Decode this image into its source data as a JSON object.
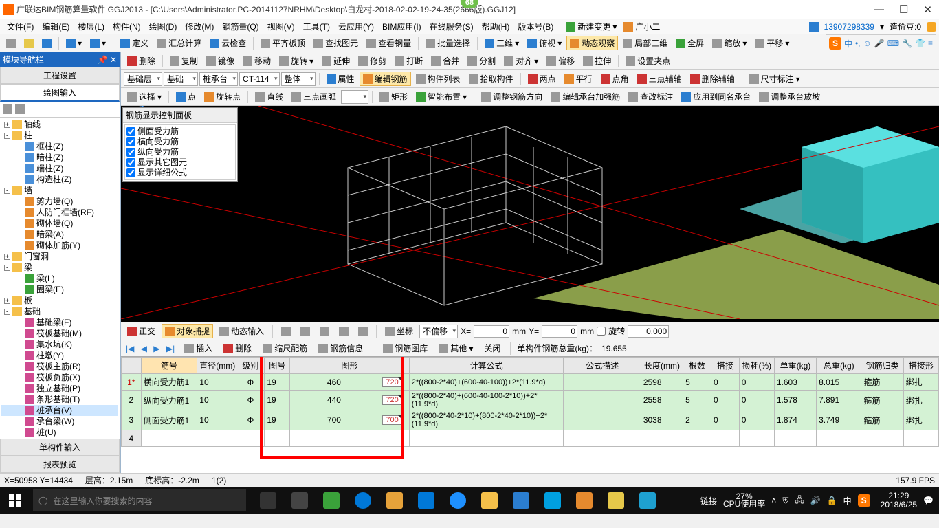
{
  "title": "广联达BIM钢筋算量软件 GGJ2013 - [C:\\Users\\Administrator.PC-20141127NRHM\\Desktop\\白龙村-2018-02-02-19-24-35(2666版).GGJ12]",
  "badge_top": "68",
  "titlebar_user_phone": "13907298339",
  "titlebar_beans_label": "造价豆:0",
  "menu": [
    "文件(F)",
    "编辑(E)",
    "楼层(L)",
    "构件(N)",
    "绘图(D)",
    "修改(M)",
    "钢筋量(Q)",
    "视图(V)",
    "工具(T)",
    "云应用(Y)",
    "BIM应用(I)",
    "在线服务(S)",
    "帮助(H)",
    "版本号(B)"
  ],
  "menu_right": {
    "new_change": "新建变更",
    "user": "广小二"
  },
  "tb1": {
    "define": "定义",
    "sum_calc": "汇总计算",
    "cloud_check": "云检查",
    "slab_top": "平齐板顶",
    "find_elem": "查找图元",
    "view_rebar": "查看钢量",
    "batch_sel": "批量选择",
    "three_d": "三维",
    "over": "俯视",
    "dyn_view": "动态观察",
    "local_3d": "局部三维",
    "fullscreen": "全屏",
    "zoom": "缩放",
    "pan": "平移"
  },
  "tb2": {
    "delete": "删除",
    "copy": "复制",
    "mirror": "镜像",
    "move": "移动",
    "rotate": "旋转",
    "extend": "延伸",
    "trim": "修剪",
    "break": "打断",
    "merge": "合并",
    "split": "分割",
    "align": "对齐",
    "offset": "偏移",
    "stretch": "拉伸",
    "set_pivot": "设置夹点"
  },
  "tb3": {
    "floor": "基础层",
    "cat": "基础",
    "type": "桩承台",
    "inst": "CT-114",
    "scope": "整体",
    "prop": "属性",
    "edit_rebar": "编辑钢筋",
    "comp_list": "构件列表",
    "pick_comp": "拾取构件",
    "two_pt": "两点",
    "parallel": "平行",
    "pt_angle": "点角",
    "three_pt_aux": "三点辅轴",
    "del_aux": "删除辅轴",
    "dim": "尺寸标注"
  },
  "tb4": {
    "select": "选择",
    "point": "点",
    "rot_pt": "旋转点",
    "line": "直线",
    "arc3": "三点画弧",
    "rect": "矩形",
    "smart": "智能布置",
    "adjust_dir": "调整钢筋方向",
    "edit_cap_rebar": "编辑承台加强筋",
    "check_annot": "查改标注",
    "apply_same": "应用到同名承台",
    "adjust_slope": "调整承台放坡"
  },
  "left": {
    "title": "模块导航栏",
    "tab1": "工程设置",
    "tab2": "绘图输入",
    "bottom1": "单构件输入",
    "bottom2": "报表预览"
  },
  "tree": [
    {
      "lvl": 0,
      "exp": "+",
      "ic": "folder",
      "t": "轴线"
    },
    {
      "lvl": 0,
      "exp": "-",
      "ic": "folder",
      "t": "柱"
    },
    {
      "lvl": 2,
      "ic": "col",
      "t": "框柱(Z)"
    },
    {
      "lvl": 2,
      "ic": "col",
      "t": "暗柱(Z)"
    },
    {
      "lvl": 2,
      "ic": "col",
      "t": "端柱(Z)"
    },
    {
      "lvl": 2,
      "ic": "col",
      "t": "构造柱(Z)"
    },
    {
      "lvl": 0,
      "exp": "-",
      "ic": "folder",
      "t": "墙"
    },
    {
      "lvl": 2,
      "ic": "wall",
      "t": "剪力墙(Q)"
    },
    {
      "lvl": 2,
      "ic": "wall",
      "t": "人防门框墙(RF)"
    },
    {
      "lvl": 2,
      "ic": "wall",
      "t": "砌体墙(Q)"
    },
    {
      "lvl": 2,
      "ic": "wall",
      "t": "暗梁(A)"
    },
    {
      "lvl": 2,
      "ic": "wall",
      "t": "砌体加筋(Y)"
    },
    {
      "lvl": 0,
      "exp": "+",
      "ic": "folder",
      "t": "门窗洞"
    },
    {
      "lvl": 0,
      "exp": "-",
      "ic": "folder",
      "t": "梁"
    },
    {
      "lvl": 2,
      "ic": "beam",
      "t": "梁(L)"
    },
    {
      "lvl": 2,
      "ic": "beam",
      "t": "圈梁(E)"
    },
    {
      "lvl": 0,
      "exp": "+",
      "ic": "folder",
      "t": "板"
    },
    {
      "lvl": 0,
      "exp": "-",
      "ic": "folder",
      "t": "基础"
    },
    {
      "lvl": 2,
      "ic": "found",
      "t": "基础梁(F)"
    },
    {
      "lvl": 2,
      "ic": "found",
      "t": "筏板基础(M)"
    },
    {
      "lvl": 2,
      "ic": "found",
      "t": "集水坑(K)"
    },
    {
      "lvl": 2,
      "ic": "found",
      "t": "柱墩(Y)"
    },
    {
      "lvl": 2,
      "ic": "found",
      "t": "筏板主筋(R)"
    },
    {
      "lvl": 2,
      "ic": "found",
      "t": "筏板负筋(X)"
    },
    {
      "lvl": 2,
      "ic": "found",
      "t": "独立基础(P)"
    },
    {
      "lvl": 2,
      "ic": "found",
      "t": "条形基础(T)"
    },
    {
      "lvl": 2,
      "ic": "found",
      "t": "桩承台(V)",
      "sel": true
    },
    {
      "lvl": 2,
      "ic": "found",
      "t": "承台梁(W)"
    },
    {
      "lvl": 2,
      "ic": "found",
      "t": "桩(U)"
    }
  ],
  "floatpanel": {
    "title": "钢筋显示控制面板",
    "items": [
      "侧面受力筋",
      "横向受力筋",
      "纵向受力筋",
      "显示其它图元",
      "显示详细公式"
    ]
  },
  "snapbar": {
    "ortho": "正交",
    "osnap": "对象捕捉",
    "dyn_input": "动态输入",
    "coord": "坐标",
    "no_offset": "不偏移",
    "X": "X=",
    "Xval": "0",
    "mm": "mm",
    "Y": "Y=",
    "Yval": "0",
    "rot": "旋转",
    "rotval": "0.000"
  },
  "gridbar": {
    "insert": "插入",
    "delete": "删除",
    "scale_jin": "缩尺配筋",
    "rebar_info": "钢筋信息",
    "rebar_lib": "钢筋图库",
    "other": "其他",
    "close": "关闭",
    "total_label": "单构件钢筋总重(kg)：",
    "total_val": "19.655"
  },
  "cols": [
    "",
    "筋号",
    "直径(mm)",
    "级别",
    "图号",
    "图形",
    "计算公式",
    "公式描述",
    "长度(mm)",
    "根数",
    "搭接",
    "损耗(%)",
    "单重(kg)",
    "总重(kg)",
    "钢筋归类",
    "搭接形"
  ],
  "rows": [
    {
      "n": "1*",
      "mark": true,
      "name": "横向受力筋1",
      "dia": "10",
      "grade": "Φ",
      "fig": "19",
      "shape": "460",
      "tag": "720",
      "formula": "2*((800-2*40)+(600-40-100))+2*(11.9*d)",
      "desc": "",
      "len": "2598",
      "cnt": "5",
      "lap": "0",
      "loss": "0",
      "uw": "1.603",
      "tw": "8.015",
      "cat": "箍筋",
      "lapf": "绑扎"
    },
    {
      "n": "2",
      "name": "纵向受力筋1",
      "dia": "10",
      "grade": "Φ",
      "fig": "19",
      "shape": "440",
      "tag": "720",
      "formula": "2*((800-2*40)+(600-40-100-2*10))+2*(11.9*d)",
      "desc": "",
      "len": "2558",
      "cnt": "5",
      "lap": "0",
      "loss": "0",
      "uw": "1.578",
      "tw": "7.891",
      "cat": "箍筋",
      "lapf": "绑扎"
    },
    {
      "n": "3",
      "name": "侧面受力筋1",
      "dia": "10",
      "grade": "Φ",
      "fig": "19",
      "shape": "700",
      "tag": "700",
      "formula": "2*((800-2*40-2*10)+(800-2*40-2*10))+2*(11.9*d)",
      "desc": "",
      "len": "3038",
      "cnt": "2",
      "lap": "0",
      "loss": "0",
      "uw": "1.874",
      "tw": "3.749",
      "cat": "箍筋",
      "lapf": "绑扎"
    },
    {
      "n": "4",
      "empty": true
    }
  ],
  "statusbar": {
    "coords": "X=50958 Y=14434",
    "floor_h": "层高：2.15m",
    "bot_elev": "底标高：-2.2m",
    "count": "1(2)",
    "fps": "157.9 FPS"
  },
  "taskbar": {
    "search_ph": "在这里输入你要搜索的内容",
    "link": "链接",
    "cpu_pct": "27%",
    "cpu_lbl": "CPU使用率",
    "ime": "中",
    "sogou": "S",
    "time": "21:29",
    "date": "2018/6/25"
  },
  "ime": {
    "zhong": "中"
  }
}
